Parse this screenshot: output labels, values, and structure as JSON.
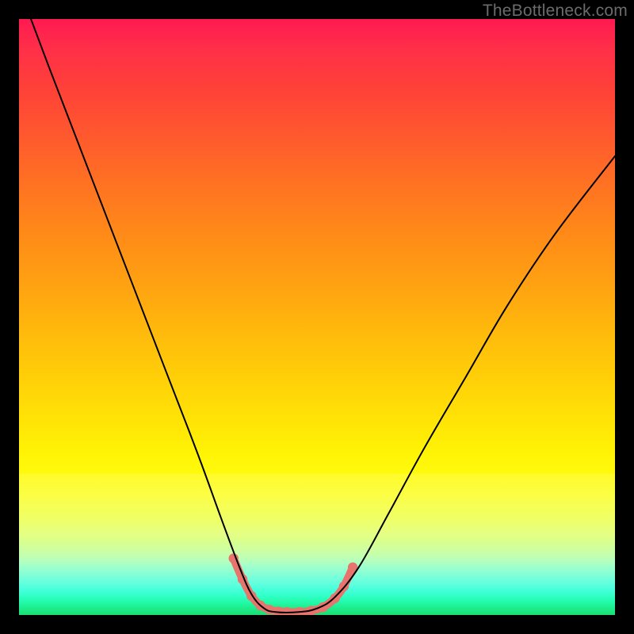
{
  "watermark": "TheBottleneck.com",
  "chart_data": {
    "type": "line",
    "title": "",
    "xlabel": "",
    "ylabel": "",
    "xlim": [
      0,
      100
    ],
    "ylim": [
      0,
      100
    ],
    "grid": false,
    "legend": false,
    "annotations": [],
    "background_gradient": {
      "orientation": "vertical",
      "stops": [
        {
          "pos": 0.0,
          "color": "#ff1a52"
        },
        {
          "pos": 0.25,
          "color": "#ff6a25"
        },
        {
          "pos": 0.5,
          "color": "#ffb80c"
        },
        {
          "pos": 0.75,
          "color": "#fff916"
        },
        {
          "pos": 0.87,
          "color": "#d2ff9b"
        },
        {
          "pos": 0.95,
          "color": "#5affde"
        },
        {
          "pos": 1.0,
          "color": "#1adf75"
        }
      ]
    },
    "series": [
      {
        "name": "main-curve",
        "color": "#000000",
        "stroke_width": 2,
        "x": [
          2,
          5,
          10,
          15,
          20,
          25,
          30,
          34,
          37,
          39,
          41,
          43,
          47,
          50,
          53,
          57,
          62,
          68,
          75,
          82,
          90,
          100
        ],
        "y": [
          100,
          92,
          79,
          66,
          53,
          40,
          27,
          16,
          8,
          3.5,
          1.2,
          0.5,
          0.5,
          1.1,
          3.0,
          8,
          17,
          28,
          40,
          52,
          64,
          77
        ]
      },
      {
        "name": "valley-highlight",
        "color": "#e8746e",
        "stroke_width": 10,
        "x": [
          36,
          37.5,
          39,
          40.5,
          42,
          43.5,
          45,
          47,
          49,
          51,
          53,
          54.5,
          56
        ],
        "y": [
          9.5,
          6.0,
          3.2,
          1.6,
          0.9,
          0.6,
          0.5,
          0.5,
          0.7,
          1.3,
          2.8,
          4.8,
          8.0
        ]
      }
    ]
  }
}
